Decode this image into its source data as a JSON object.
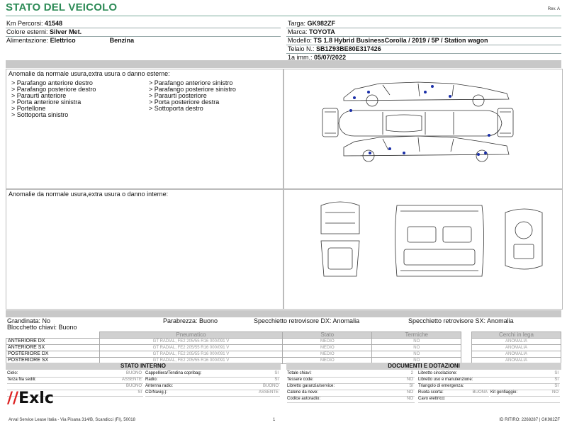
{
  "header": {
    "title": "STATO DEL VEICOLO",
    "rev": "Rev. A"
  },
  "vehicle": {
    "km_label": "Km Percorsi:",
    "km_value": "41548",
    "color_label": "Colore esterni:",
    "color_value": "Silver Met.",
    "fuel_label": "Alimentazione:",
    "fuel_value": "Elettrico",
    "fuel_value2": "Benzina",
    "plate_label": "Targa:",
    "plate_value": "GK982ZF",
    "brand_label": "Marca:",
    "brand_value": "TOYOTA",
    "model_label": "Modello:",
    "model_value": "TS 1.8 Hybrid BusinessCorolla / 2019 / 5P / Station wagon",
    "vin_label": "Telaio N.:",
    "vin_value": "SB1Z93BE80E317426",
    "reg_label": "1a imm.:",
    "reg_value": "05/07/2022"
  },
  "external": {
    "title": "Anomalie da normale usura,extra usura o danno esterne:",
    "left": [
      "> Parafango anteriore destro",
      "> Parafango posteriore destro",
      "> Paraurti anteriore",
      "> Porta anteriore sinistra",
      "> Portellone",
      "> Sottoporta sinistro"
    ],
    "right": [
      "> Parafango anteriore sinistro",
      "> Parafango posteriore sinistro",
      "> Paraurti posteriore",
      "> Porta posteriore destra",
      "> Sottoporta destro"
    ]
  },
  "internal": {
    "title": "Anomalie da normale usura,extra usura o danno interne:"
  },
  "status": {
    "grandinata": "Grandinata: No",
    "parabrezza": "Parabrezza: Buono",
    "specchio_dx": "Specchietto retrovisore DX: Anomalia",
    "specchio_sx": "Specchietto retrovisore SX: Anomalia",
    "blocchetto": "Blocchetto chiavi: Buono"
  },
  "tyres": {
    "headers": [
      "Pneumatico",
      "Stato",
      "Termiche",
      "Cerchi in lega"
    ],
    "rows": [
      {
        "pos": "ANTERIORE DX",
        "tyre": "GT RADIAL, FE2 205/55 R16 000/091 V",
        "state": "MEDIO",
        "thermal": "NO",
        "rims": "ANOMALIA"
      },
      {
        "pos": "ANTERIORE SX",
        "tyre": "GT RADIAL, FE2 205/55 R16 000/091 V",
        "state": "MEDIO",
        "thermal": "NO",
        "rims": "ANOMALIA"
      },
      {
        "pos": "POSTERIORE DX",
        "tyre": "GT RADIAL, FE2 205/55 R16 000/091 V",
        "state": "MEDIO",
        "thermal": "NO",
        "rims": "ANOMALIA"
      },
      {
        "pos": "POSTERIORE SX",
        "tyre": "GT RADIAL, FE2 205/55 R16 000/091 V",
        "state": "MEDIO",
        "thermal": "NO",
        "rims": "ANOMALIA"
      }
    ]
  },
  "interno": {
    "title": "STATO INTERNO",
    "col1": [
      {
        "label": "Cielo:",
        "value": "BUONO"
      },
      {
        "label": "Terza fila sedili:",
        "value": "ASSENTE"
      },
      {
        "label": "",
        "value": "BUONO"
      },
      {
        "label": "",
        "value": "SI"
      }
    ],
    "col2": [
      {
        "label": "Cappelliera/Tendina copribag:",
        "value": "SI"
      },
      {
        "label": "Radio:",
        "value": "SI"
      },
      {
        "label": "Antenna radio:",
        "value": "BUONO"
      },
      {
        "label": "CD/Navig.):",
        "value": "ASSENTE"
      }
    ]
  },
  "documenti": {
    "title": "DOCUMENTI E DOTAZIONI",
    "col1": [
      {
        "label": "Totale chiavi:",
        "value": "2"
      },
      {
        "label": "Tessere code:",
        "value": "NO"
      },
      {
        "label": "Libretto garanzia/service:",
        "value": "SI"
      },
      {
        "label": "Catene da neve:",
        "value": "NO"
      },
      {
        "label": "Codice autoradio:",
        "value": "NO"
      }
    ],
    "col2": [
      {
        "label": "Libretto circolazione:",
        "value": "SI"
      },
      {
        "label": "Libretto uso e manutenzione:",
        "value": "SI"
      },
      {
        "label": "Triangolo di emergenza:",
        "value": "SI"
      },
      {
        "label": "Ruota scorta:",
        "value": "BUONA"
      },
      {
        "label": "Cavo elettrico:",
        "value": ""
      }
    ],
    "kit_label": "Kit gonfiaggio:",
    "kit_value": "NO"
  },
  "footer": {
    "company": "Arval Service Lease Italia - Via Pisana 314/B, Scandicci (FI), 50018",
    "page": "1",
    "id": "ID RITIRO: 2268287 | GK982ZF"
  },
  "logo": {
    "slash": "//",
    "text": "Exlc"
  },
  "colors": {
    "title": "#2e8b57",
    "damage_dot": "#1a2fa8",
    "header_gray": "#c8c8c8"
  }
}
